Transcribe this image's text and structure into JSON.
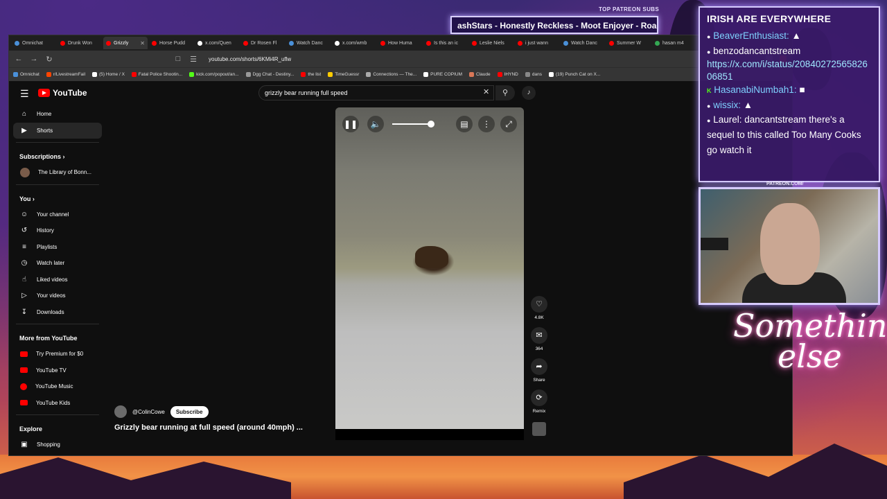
{
  "overlay": {
    "patreon_label": "TOP PATREON SUBS",
    "ticker": "ashStars - Honestly Reckless - Moot Enjoyer - Roadkill - F",
    "neon_text_1": "Something",
    "neon_text_2": "else",
    "patreon_tag": "PATREON.COM/"
  },
  "browser": {
    "tabs": [
      {
        "label": "Omnichat",
        "color": "#4a90d9"
      },
      {
        "label": "Drunk Won",
        "color": "#ff0000"
      },
      {
        "label": "Grizzly",
        "color": "#ff0000",
        "active": true
      },
      {
        "label": "Horse Pudd",
        "color": "#ff0000"
      },
      {
        "label": "x.com/Quen",
        "color": "#ffffff"
      },
      {
        "label": "Dr Rosen Fl",
        "color": "#ff0000"
      },
      {
        "label": "Watch Danc",
        "color": "#4a90d9"
      },
      {
        "label": "x.com/wmb",
        "color": "#ffffff"
      },
      {
        "label": "How Huma",
        "color": "#ff0000"
      },
      {
        "label": "Is this an ic",
        "color": "#ff0000"
      },
      {
        "label": "Leslie Niels",
        "color": "#ff0000"
      },
      {
        "label": "i just wann",
        "color": "#ff0000"
      },
      {
        "label": "Watch Danc",
        "color": "#4a90d9"
      },
      {
        "label": "Summer W",
        "color": "#ff0000"
      },
      {
        "label": "hasan m4",
        "color": "#34a853"
      }
    ],
    "url": "youtube.com/shorts/6KMi4R_uflw",
    "bookmarks": [
      {
        "label": "Omnichat",
        "color": "#4a90d9"
      },
      {
        "label": "r/LivestreamFail",
        "color": "#ff4500"
      },
      {
        "label": "(5) Home / X",
        "color": "#ffffff"
      },
      {
        "label": "Fatal Police Shootin...",
        "color": "#ff0000"
      },
      {
        "label": "kick.com/popout/an...",
        "color": "#53fc18"
      },
      {
        "label": "Dgg Chat - Destiny...",
        "color": "#999999"
      },
      {
        "label": "the list",
        "color": "#ff0000"
      },
      {
        "label": "TimeGuessr",
        "color": "#ffcc00"
      },
      {
        "label": "Connections — The...",
        "color": "#aaaaaa"
      },
      {
        "label": "PURE COPIUM",
        "color": "#ffffff"
      },
      {
        "label": "Claude",
        "color": "#d97757"
      },
      {
        "label": "IHYND",
        "color": "#ff0000"
      },
      {
        "label": "dans",
        "color": "#888888"
      },
      {
        "label": "(19) Punch Cat on X...",
        "color": "#ffffff"
      }
    ]
  },
  "youtube": {
    "logo": "YouTube",
    "search_value": "grizzly bear running full speed",
    "sidebar": {
      "main": [
        "Home",
        "Shorts"
      ],
      "subscriptions_head": "Subscriptions",
      "subscriptions": [
        "The Library of Bonn..."
      ],
      "you_head": "You",
      "you": [
        "Your channel",
        "History",
        "Playlists",
        "Watch later",
        "Liked videos",
        "Your videos",
        "Downloads"
      ],
      "more_head": "More from YouTube",
      "more": [
        "Try Premium for $0",
        "YouTube TV",
        "YouTube Music",
        "YouTube Kids"
      ],
      "explore_head": "Explore",
      "explore": [
        "Shopping"
      ]
    },
    "short": {
      "channel": "@ColinCowe",
      "subscribe": "Subscribe",
      "title": "Grizzly bear running at full speed (around 40mph) ...",
      "volume": 1.0,
      "likes": "4.8K",
      "comments": "364",
      "share": "Share",
      "remix": "Remix"
    }
  },
  "chat": {
    "title": "IRISH ARE EVERYWHERE",
    "lines": [
      {
        "user": "BeaverEnthusiast:",
        "msg": ""
      },
      {
        "user": "benzo",
        "msg": "dancantstream"
      },
      {
        "user": "",
        "msg": "https://x.com/i/status/2084027256582606851"
      },
      {
        "user": "HasanabiNumbah1:",
        "msg": ""
      },
      {
        "user": "wissix:",
        "msg": ""
      },
      {
        "user": "Laurel:",
        "msg": "dancantstream there's a sequel to this called Too Many Cooks go watch it"
      }
    ]
  }
}
